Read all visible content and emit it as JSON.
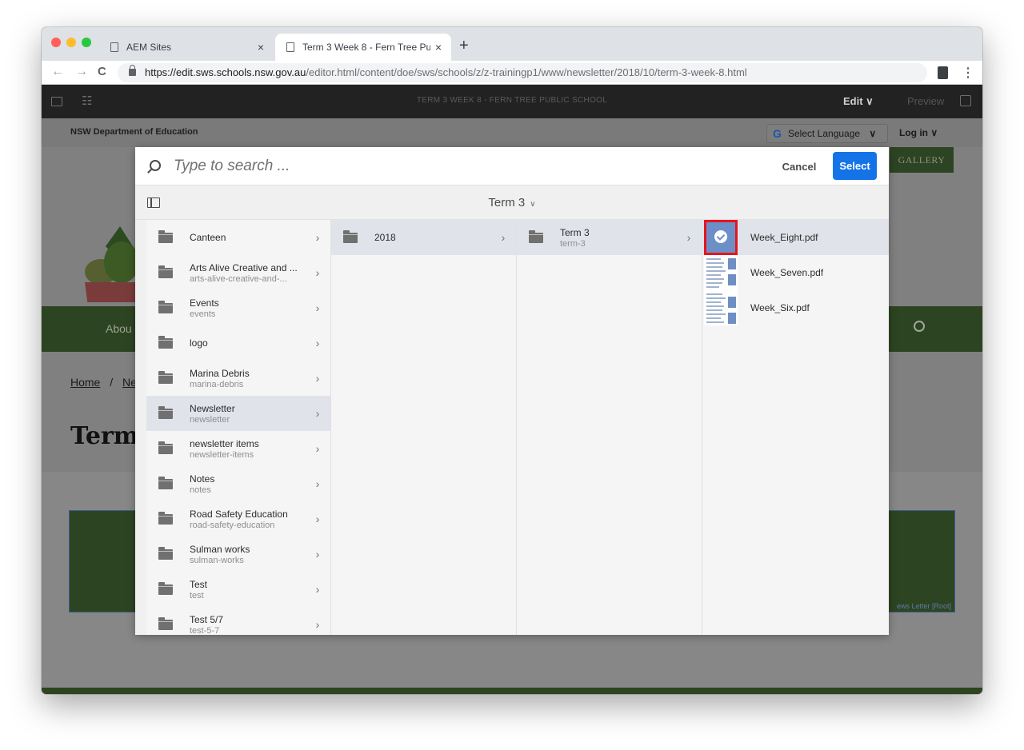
{
  "browser": {
    "tabs": [
      {
        "title": "AEM Sites",
        "close": "×"
      },
      {
        "title": "Term 3 Week 8 - Fern Tree Public School",
        "close": "×"
      }
    ],
    "new_tab": "+",
    "nav": {
      "back": "←",
      "forward": "→",
      "reload": "C"
    },
    "url_host": "https://edit.sws.schools.nsw.gov.au",
    "url_path": "/editor.html/content/doe/sws/schools/z/z-trainingp1/www/newsletter/2018/10/term-3-week-8.html",
    "menu": "⋮"
  },
  "editor_bar": {
    "title": "TERM 3 WEEK 8 - FERN TREE PUBLIC SCHOOL",
    "mode": "Edit ∨",
    "preview": "Preview"
  },
  "page": {
    "department": "NSW Department of Education",
    "language_label": "Select Language",
    "language_arrow": "∨",
    "login": "Log in ∨",
    "gallery": "GALLERY",
    "nav_partial": "Abou",
    "breadcrumb_home": "Home",
    "breadcrumb_sep": "/",
    "breadcrumb_next": "Ne",
    "heading_partial": "Term",
    "component_tag": "ews Letter [Root]",
    "colors": {
      "brand_green": "#2d4422",
      "accent_blue": "#1473e6",
      "highlight_red": "#e8141c"
    }
  },
  "dialog": {
    "search_placeholder": "Type to search ...",
    "cancel_label": "Cancel",
    "select_label": "Select",
    "current_folder": "Term 3",
    "current_folder_chevron": "∨",
    "column1": [
      {
        "title": "Canteen",
        "name": ""
      },
      {
        "title": "Arts Alive Creative and ...",
        "name": "arts-alive-creative-and-..."
      },
      {
        "title": "Events",
        "name": "events"
      },
      {
        "title": "logo",
        "name": ""
      },
      {
        "title": "Marina Debris",
        "name": "marina-debris"
      },
      {
        "title": "Newsletter",
        "name": "newsletter"
      },
      {
        "title": "newsletter items",
        "name": "newsletter-items"
      },
      {
        "title": "Notes",
        "name": "notes"
      },
      {
        "title": "Road Safety Education",
        "name": "road-safety-education"
      },
      {
        "title": "Sulman works",
        "name": "sulman-works"
      },
      {
        "title": "Test",
        "name": "test"
      },
      {
        "title": "Test 5/7",
        "name": "test-5-7"
      }
    ],
    "column2": [
      {
        "title": "2018",
        "name": ""
      }
    ],
    "column3": [
      {
        "title": "Term 3",
        "name": "term-3"
      }
    ],
    "column4": [
      {
        "title": "Week_Eight.pdf",
        "selected": true
      },
      {
        "title": "Week_Seven.pdf",
        "selected": false
      },
      {
        "title": "Week_Six.pdf",
        "selected": false
      }
    ],
    "chevron": "›"
  }
}
